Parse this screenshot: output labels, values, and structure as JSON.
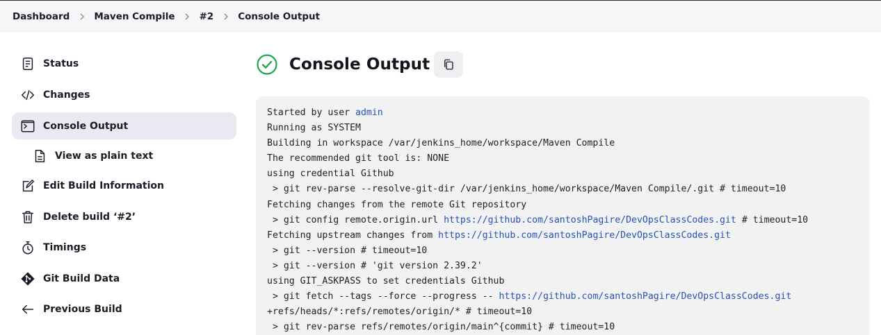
{
  "breadcrumb": [
    "Dashboard",
    "Maven Compile",
    "#2",
    "Console Output"
  ],
  "sidebar": {
    "items": [
      {
        "label": "Status",
        "icon": "status-icon"
      },
      {
        "label": "Changes",
        "icon": "code-icon"
      },
      {
        "label": "Console Output",
        "icon": "terminal-icon",
        "active": true
      },
      {
        "label": "View as plain text",
        "icon": "document-icon",
        "sub": true
      },
      {
        "label": "Edit Build Information",
        "icon": "edit-icon"
      },
      {
        "label": "Delete build ‘#2’",
        "icon": "trash-icon"
      },
      {
        "label": "Timings",
        "icon": "stopwatch-icon"
      },
      {
        "label": "Git Build Data",
        "icon": "git-icon"
      },
      {
        "label": "Previous Build",
        "icon": "arrow-left-icon"
      }
    ]
  },
  "main": {
    "title": "Console Output",
    "status_color": "#1ea64b"
  },
  "console": {
    "lines": [
      [
        "Started by user ",
        {
          "link": "admin"
        }
      ],
      [
        "Running as SYSTEM"
      ],
      [
        "Building in workspace /var/jenkins_home/workspace/Maven Compile"
      ],
      [
        "The recommended git tool is: NONE"
      ],
      [
        "using credential Github"
      ],
      [
        " > git rev-parse --resolve-git-dir /var/jenkins_home/workspace/Maven Compile/.git # timeout=10"
      ],
      [
        "Fetching changes from the remote Git repository"
      ],
      [
        " > git config remote.origin.url ",
        {
          "link": "https://github.com/santoshPagire/DevOpsClassCodes.git"
        },
        " # timeout=10"
      ],
      [
        "Fetching upstream changes from ",
        {
          "link": "https://github.com/santoshPagire/DevOpsClassCodes.git"
        }
      ],
      [
        " > git --version # timeout=10"
      ],
      [
        " > git --version # 'git version 2.39.2'"
      ],
      [
        "using GIT_ASKPASS to set credentials Github"
      ],
      [
        " > git fetch --tags --force --progress -- ",
        {
          "link": "https://github.com/santoshPagire/DevOpsClassCodes.git"
        }
      ],
      [
        "+refs/heads/*:refs/remotes/origin/* # timeout=10"
      ],
      [
        " > git rev-parse refs/remotes/origin/main^{commit} # timeout=10"
      ]
    ]
  }
}
